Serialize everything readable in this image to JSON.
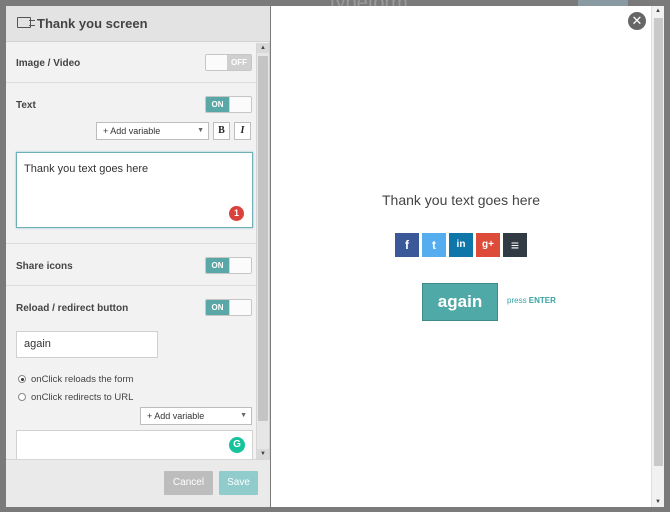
{
  "background": {
    "title": "typeform"
  },
  "panel": {
    "title": "Thank you screen",
    "image_video": {
      "label": "Image / Video",
      "toggle": "OFF"
    },
    "text": {
      "label": "Text",
      "toggle": "ON",
      "add_variable": "+ Add variable",
      "bold": "B",
      "italic": "I",
      "value": "Thank you text goes here",
      "badge": "1"
    },
    "share_icons": {
      "label": "Share icons",
      "toggle": "ON"
    },
    "reload_redirect": {
      "label": "Reload / redirect button",
      "toggle": "ON",
      "button_text": "again",
      "option_reload": "onClick reloads the form",
      "option_redirect": "onClick redirects to URL",
      "add_variable": "+ Add variable",
      "grammarly": "G"
    },
    "footer": {
      "cancel": "Cancel",
      "save": "Save"
    }
  },
  "preview": {
    "text": "Thank you text goes here",
    "share": [
      {
        "name": "facebook",
        "glyph": "f",
        "color": "#3b5998"
      },
      {
        "name": "twitter",
        "glyph": "t",
        "color": "#55acee"
      },
      {
        "name": "linkedin",
        "glyph": "in",
        "color": "#0e76a8"
      },
      {
        "name": "google-plus",
        "glyph": "g+",
        "color": "#dd4b39"
      },
      {
        "name": "buffer",
        "glyph": "≡",
        "color": "#323b43"
      }
    ],
    "button": "again",
    "press": "press",
    "enter": "ENTER",
    "close": "✕"
  }
}
